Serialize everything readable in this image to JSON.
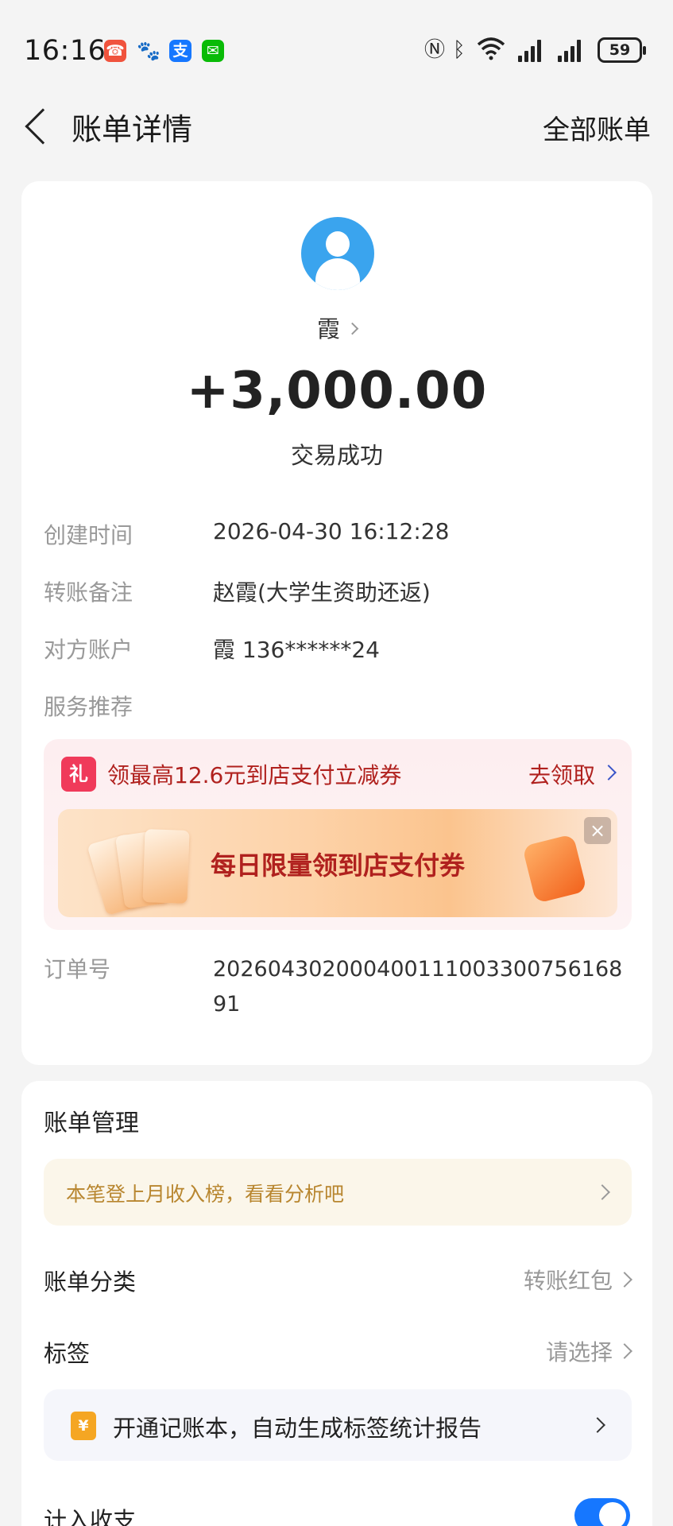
{
  "status_bar": {
    "time": "16:16",
    "battery": "59",
    "icons": [
      "call-missed-icon",
      "baidu-icon",
      "alipay-icon",
      "wechat-icon",
      "nfc-icon",
      "bluetooth-icon",
      "wifi-icon",
      "signal-icon",
      "signal-icon",
      "battery-icon"
    ]
  },
  "nav": {
    "title": "账单详情",
    "right": "全部账单"
  },
  "detail": {
    "payee": "霞",
    "amount": "+3,000.00",
    "status": "交易成功",
    "rows": [
      {
        "label": "创建时间",
        "value": "2026-04-30 16:12:28"
      },
      {
        "label": "转账备注",
        "value": "赵霞(大学生资助还返)"
      },
      {
        "label": "对方账户",
        "value": "霞 136******24"
      },
      {
        "label": "服务推荐",
        "value": ""
      }
    ],
    "promo": {
      "gift_char": "礼",
      "text": "领最高12.6元到店支付立减券",
      "link": "去领取",
      "banner": "每日限量领到店支付券"
    },
    "order_label": "订单号",
    "order_value": "20260430200040011100330075616891"
  },
  "management": {
    "title": "账单管理",
    "tip": "本笔登上月收入榜，看看分析吧",
    "category_label": "账单分类",
    "category_value": "转账红包",
    "tag_label": "标签",
    "tag_value": "请选择",
    "note_icon": "¥",
    "note_text": "开通记账本，自动生成标签统计报告",
    "include_label": "计入收支",
    "include_on": true
  },
  "colors": {
    "accent": "#1677ff",
    "avatar": "#3aa4ee",
    "promo_text": "#b0211e"
  }
}
